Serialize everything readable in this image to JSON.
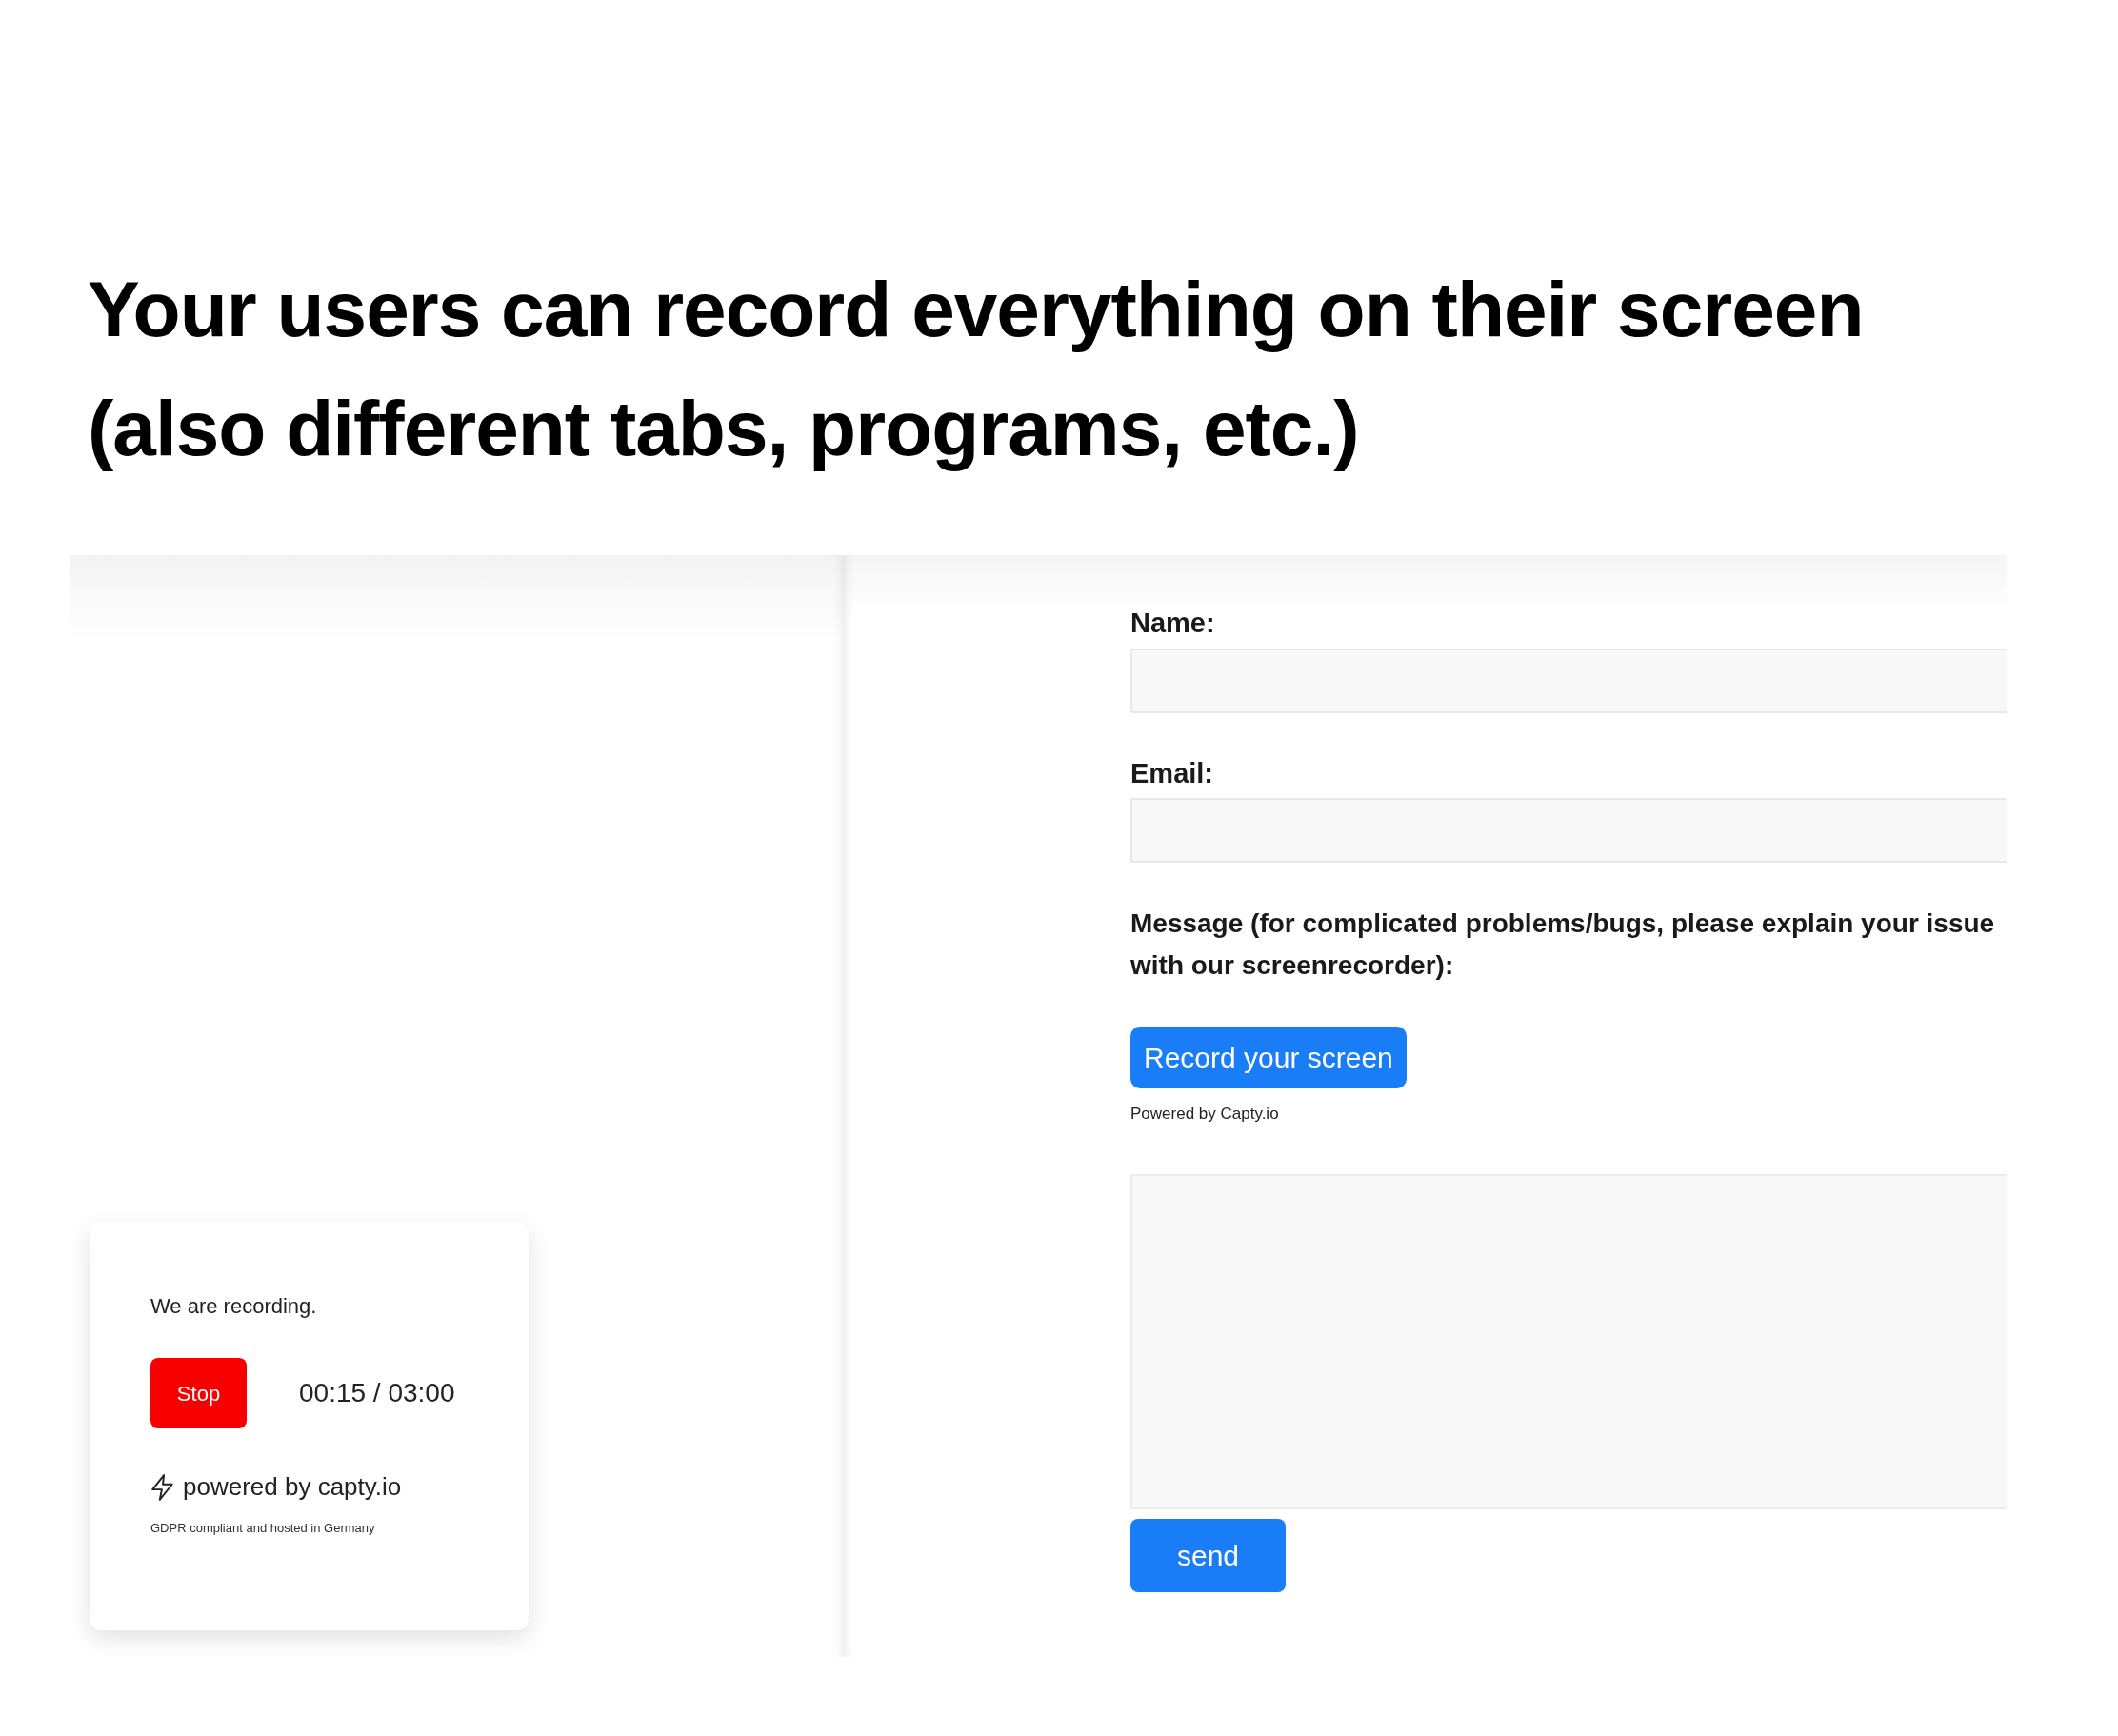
{
  "heading": "Your users can record everything on their screen (also different tabs, programs, etc.)",
  "recorder": {
    "status": "We are recording.",
    "stop_button": "Stop",
    "timer": "00:15 / 03:00",
    "powered_by": "powered by capty.io",
    "note": "GDPR compliant and hosted in Germany"
  },
  "form": {
    "fields": [
      {
        "label": "Name:",
        "kind": "input"
      },
      {
        "label": "Email:",
        "kind": "input"
      }
    ],
    "message_label": "Message (for complicated problems/bugs, please explain your issue with our screenrecorder):",
    "record_button": "Record your screen",
    "powered_by": "Powered by Capty.io",
    "submit_button": "send"
  }
}
